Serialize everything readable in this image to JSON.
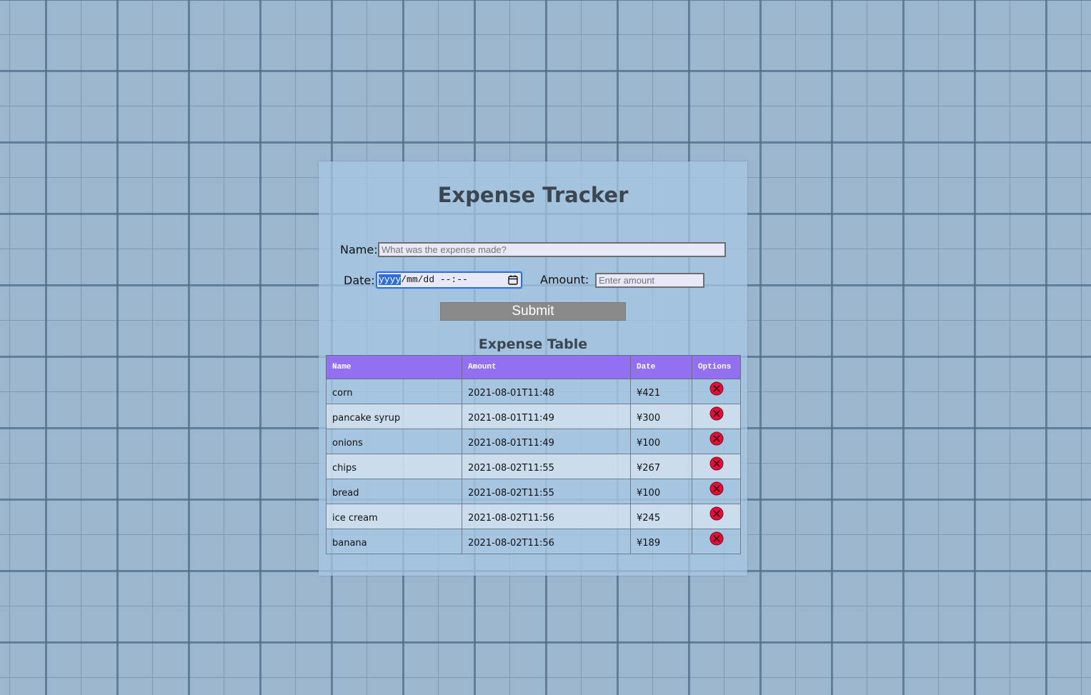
{
  "page": {
    "title": "Expense Tracker"
  },
  "form": {
    "name_label": "Name:",
    "name_placeholder": "What was the expense made?",
    "name_value": "",
    "date_label": "Date:",
    "date_placeholder_year": "yyyy",
    "date_placeholder_rest": "/mm/dd --:--",
    "amount_label": "Amount:",
    "amount_placeholder": "Enter amount",
    "amount_value": "",
    "submit_label": "Submit"
  },
  "table": {
    "title": "Expense Table",
    "headers": [
      "Name",
      "Amount",
      "Date",
      "Options"
    ],
    "rows": [
      {
        "name": "corn",
        "amount": "2021-08-01T11:48",
        "date": "¥421"
      },
      {
        "name": "pancake syrup",
        "amount": "2021-08-01T11:49",
        "date": "¥300"
      },
      {
        "name": "onions",
        "amount": "2021-08-01T11:49",
        "date": "¥100"
      },
      {
        "name": "chips",
        "amount": "2021-08-02T11:55",
        "date": "¥267"
      },
      {
        "name": "bread",
        "amount": "2021-08-02T11:55",
        "date": "¥100"
      },
      {
        "name": "ice cream",
        "amount": "2021-08-02T11:56",
        "date": "¥245"
      },
      {
        "name": "banana",
        "amount": "2021-08-02T11:56",
        "date": "¥189"
      }
    ]
  },
  "icons": {
    "delete": "delete-icon",
    "calendar": "calendar-icon"
  },
  "colors": {
    "header_bg": "#9370f0",
    "submit_bg": "#8a8a8a",
    "delete_red": "#e0103a",
    "focus_blue": "#2f6fd6"
  }
}
